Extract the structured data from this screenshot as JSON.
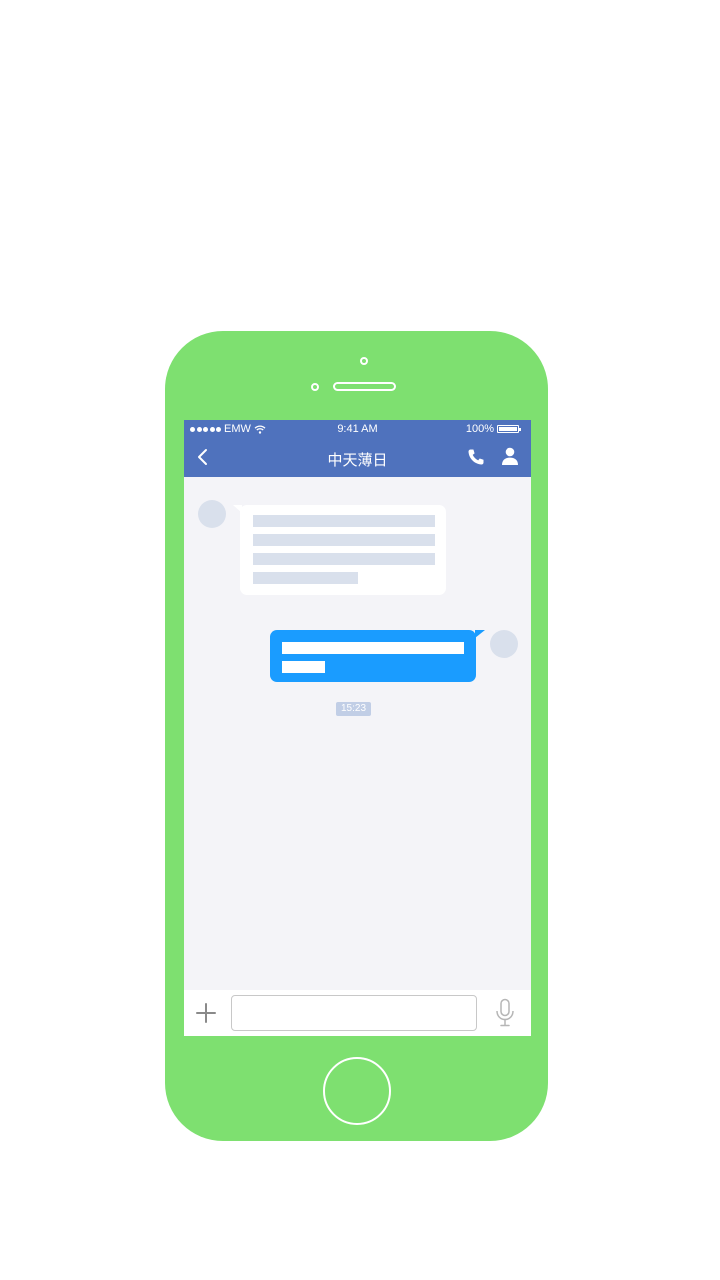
{
  "status_bar": {
    "carrier": "EMW",
    "time": "9:41 AM",
    "battery": "100%"
  },
  "nav": {
    "title": "中天薄日",
    "back_icon": "chevron-left-icon",
    "call_icon": "phone-icon",
    "profile_icon": "user-icon"
  },
  "conversation": {
    "timestamp": "15:23"
  },
  "input_bar": {
    "add_icon": "plus-icon",
    "message_value": "",
    "voice_icon": "microphone-icon"
  },
  "colors": {
    "device_body": "#7ee070",
    "nav_background": "#4f72bd",
    "chat_background": "#f4f4f8",
    "outgoing_bubble": "#1a9cff",
    "incoming_bubble": "#ffffff",
    "placeholder_line": "#d9e0ec"
  }
}
